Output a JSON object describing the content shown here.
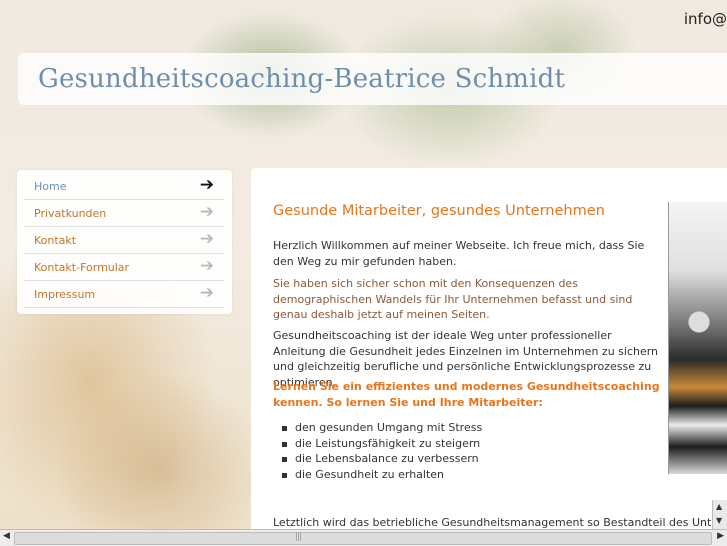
{
  "header": {
    "title": "Gesundheitscoaching-Beatrice Schmidt",
    "top_right_text": "info@"
  },
  "nav": {
    "items": [
      {
        "label": "Home",
        "active": true
      },
      {
        "label": "Privatkunden",
        "active": false
      },
      {
        "label": "Kontakt",
        "active": false
      },
      {
        "label": "Kontakt-Formular",
        "active": false
      },
      {
        "label": "Impressum",
        "active": false
      }
    ],
    "arrow_glyph": "➔"
  },
  "content": {
    "headline": "Gesunde Mitarbeiter, gesundes Unternehmen",
    "paragraphs": [
      "Herzlich Willkommen auf meiner Webseite. Ich freue mich, dass Sie den Weg zu mir gefunden haben.",
      "Sie haben sich sicher schon mit den Konsequenzen des demographischen Wandels für Ihr Unternehmen befasst und sind genau deshalb jetzt auf meinen Seiten.",
      "Gesundheitscoaching ist der ideale Weg unter professioneller Anleitung die Gesundheit jedes Einzelnen im Unternehmen zu sichern und gleichzeitig berufliche und persönliche Entwicklungsprozesse zu optimieren.",
      "Lernen Sie ein effizientes und modernes Gesundheitscoaching kennen. So lernen Sie und Ihre Mitarbeiter:"
    ],
    "bullets": [
      "den gesunden Umgang mit Stress",
      "die Leistungsfähigkeit zu steigern",
      "die Lebensbalance zu verbessern",
      "die Gesundheit zu erhalten"
    ],
    "bottom_text": "Letztlich wird das betriebliche Gesundheitsmanagement so Bestandteil des Unternehmen"
  },
  "scrollbars": {
    "up_glyph": "▲",
    "down_glyph": "▼",
    "left_glyph": "◀",
    "right_glyph": "▶",
    "grip_glyph": "|||"
  },
  "colors": {
    "title": "#6e8fac",
    "accent_orange": "#e8751a",
    "nav_link": "#c0772a",
    "nav_active": "#6f90b4"
  }
}
